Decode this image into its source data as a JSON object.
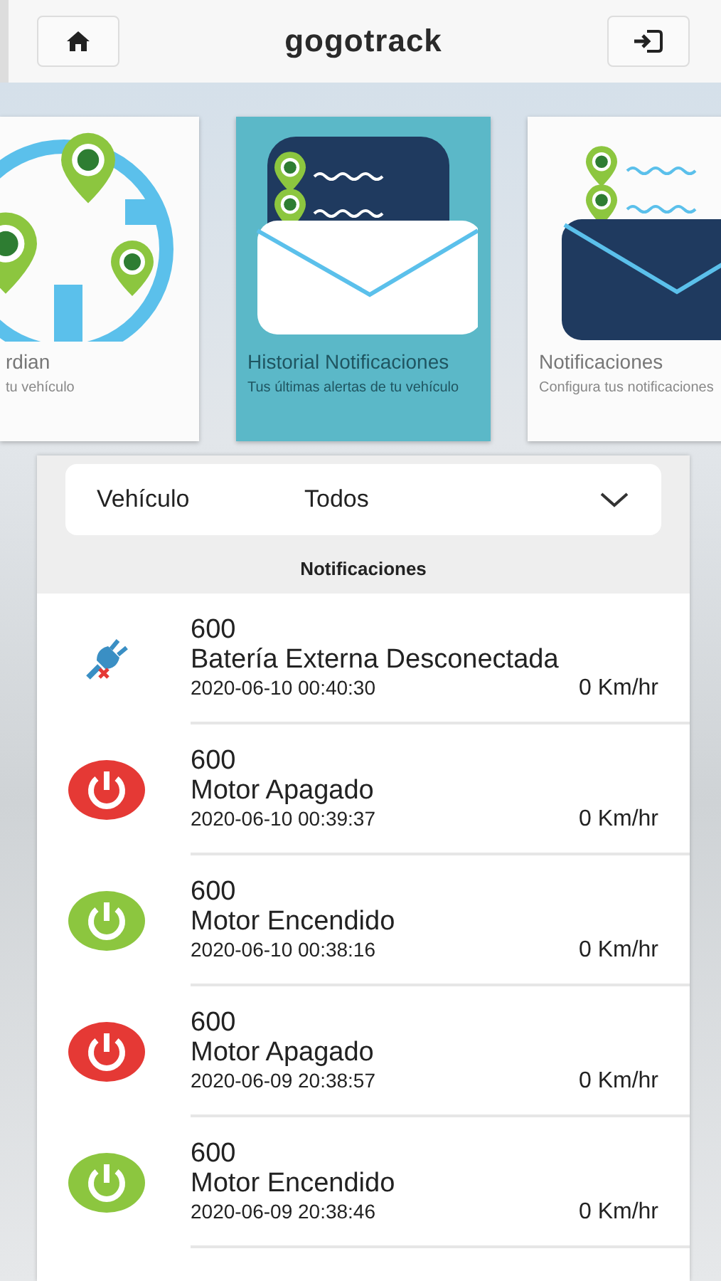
{
  "header": {
    "logo": "gogotrack"
  },
  "cards": [
    {
      "kind": "map",
      "title": "rdian",
      "subtitle": "tu vehículo",
      "selected": false
    },
    {
      "kind": "history",
      "title": "Historial Notificaciones",
      "subtitle": "Tus últimas alertas de tu vehículo",
      "selected": true
    },
    {
      "kind": "settings",
      "title": "Notificaciones",
      "subtitle": "Configura tus notificaciones",
      "selected": false
    }
  ],
  "filter": {
    "label": "Vehículo",
    "value": "Todos"
  },
  "list_title": "Notificaciones",
  "notifications": [
    {
      "kind": "battery",
      "unit": "600",
      "event": "Batería Externa Desconectada",
      "time": "2020-06-10 00:40:30",
      "speed": "0 Km/hr"
    },
    {
      "kind": "engine_off",
      "unit": "600",
      "event": "Motor Apagado",
      "time": "2020-06-10 00:39:37",
      "speed": "0 Km/hr"
    },
    {
      "kind": "engine_on",
      "unit": "600",
      "event": "Motor Encendido",
      "time": "2020-06-10 00:38:16",
      "speed": "0 Km/hr"
    },
    {
      "kind": "engine_off",
      "unit": "600",
      "event": "Motor Apagado",
      "time": "2020-06-09 20:38:57",
      "speed": "0 Km/hr"
    },
    {
      "kind": "engine_on",
      "unit": "600",
      "event": "Motor Encendido",
      "time": "2020-06-09 20:38:46",
      "speed": "0 Km/hr"
    }
  ]
}
